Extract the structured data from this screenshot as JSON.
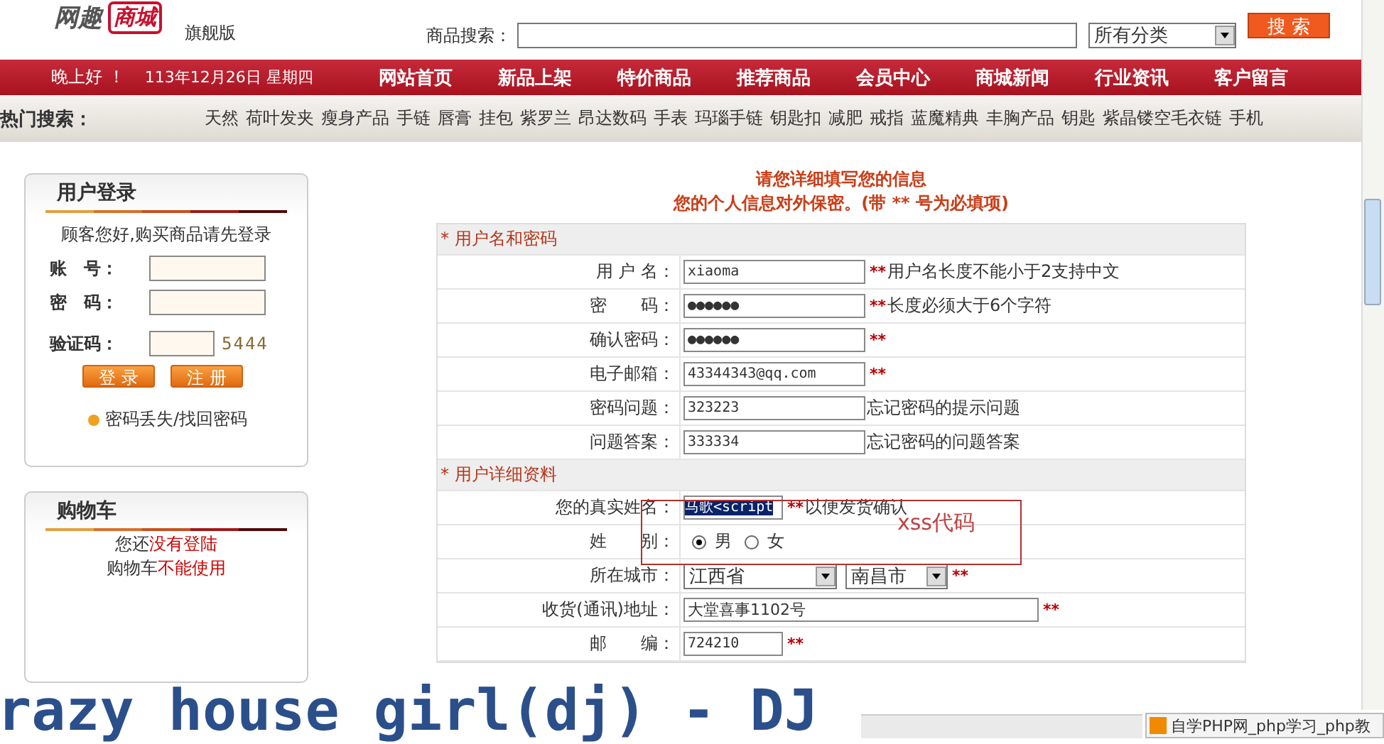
{
  "header": {
    "logo_text": "网趣",
    "logo_mark": "商城",
    "edition": "旗舰版",
    "search_label": "商品搜索：",
    "category": "所有分类",
    "search_button": "搜 索"
  },
  "nav": {
    "greeting": "晚上好 ！",
    "date": "113年12月26日 星期四",
    "items": [
      {
        "label": "网站首页"
      },
      {
        "label": "新品上架"
      },
      {
        "label": "特价商品"
      },
      {
        "label": "推荐商品"
      },
      {
        "label": "会员中心"
      },
      {
        "label": "商城新闻"
      },
      {
        "label": "行业资讯"
      },
      {
        "label": "客户留言"
      }
    ]
  },
  "hot_search": {
    "label": "热门搜索：",
    "items": [
      "天然",
      "荷叶发夹",
      "瘦身产品",
      "手链",
      "唇膏",
      "挂包",
      "紫罗兰",
      "昂达数码",
      "手表",
      "玛瑙手链",
      "钥匙扣",
      "减肥",
      "戒指",
      "蓝魔精典",
      "丰胸产品",
      "钥匙",
      "紫晶镂空毛衣链",
      "手机"
    ]
  },
  "login": {
    "title": "用户登录",
    "intro": "顾客您好,购买商品请先登录",
    "account_label": "账　号：",
    "password_label": "密　码：",
    "captcha_label": "验证码：",
    "captcha": "5444",
    "login_button": "登 录",
    "register_button": "注 册",
    "recover_link": "密码丢失/找回密码"
  },
  "cart": {
    "title": "购物车",
    "line1": "您还",
    "line1_red": "没有登陆",
    "line2": "购物车",
    "line2_red": "不能使用"
  },
  "form": {
    "heading": "请您详细填写您的信息",
    "subheading": "您的个人信息对外保密。(带 ** 号为必填项)",
    "sections": [
      {
        "title": "* 用户名和密码",
        "rows": [
          {
            "kind": "text",
            "label": "用 户 名：",
            "value": "xiaoma",
            "mark": "**",
            "hint": "用户名长度不能小于2支持中文"
          },
          {
            "kind": "text",
            "label": "密　　码：",
            "value": "●●●●●●",
            "mark": "**",
            "hint": "长度必须大于6个字符"
          },
          {
            "kind": "text",
            "label": "确认密码：",
            "value": "●●●●●●",
            "mark": "**"
          },
          {
            "kind": "text",
            "label": "电子邮箱：",
            "value": "43344343@qq.com",
            "mark": "**"
          },
          {
            "kind": "text",
            "label": "密码问题：",
            "value": "323223",
            "hint": "忘记密码的提示问题"
          },
          {
            "kind": "text",
            "label": "问题答案：",
            "value": "333334",
            "hint": "忘记密码的问题答案"
          }
        ]
      },
      {
        "title": "* 用户详细资料",
        "rows": [
          {
            "kind": "selected_text",
            "label": "您的真实姓名：",
            "value": "马歌<script",
            "mark": "**",
            "hint": "以便发货确认"
          },
          {
            "kind": "radio",
            "label": "姓　　别：",
            "options": [
              {
                "label": "男",
                "selected": true
              },
              {
                "label": "女",
                "selected": false
              }
            ]
          },
          {
            "kind": "selects",
            "label": "所在城市：",
            "selects": [
              "江西省",
              "南昌市"
            ],
            "mark": "**"
          },
          {
            "kind": "wide_text",
            "label": "收货(通讯)地址：",
            "value": "大堂喜事1102号",
            "mark": "**"
          },
          {
            "kind": "text_short",
            "label": "邮　　编：",
            "value": "724210",
            "mark": "**"
          }
        ]
      }
    ]
  },
  "annotation": "xss代码",
  "lyric": "razy house girl(dj) - DJ",
  "taskbar_item": "自学PHP网_php学习_php教"
}
